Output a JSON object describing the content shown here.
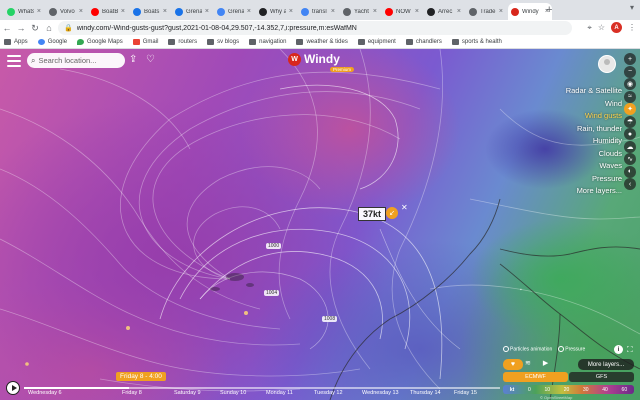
{
  "browser": {
    "tabs": [
      {
        "label": "Whats",
        "favicon_color": "#25d366",
        "active": false
      },
      {
        "label": "Volvo",
        "favicon_color": "#5f6368",
        "active": false
      },
      {
        "label": "BoatB",
        "favicon_color": "#ff0000",
        "active": false
      },
      {
        "label": "Boats",
        "favicon_color": "#1a73e8",
        "active": false
      },
      {
        "label": "Grena",
        "favicon_color": "#1a73e8",
        "active": false
      },
      {
        "label": "Grena",
        "favicon_color": "#4285f4",
        "active": false
      },
      {
        "label": "Why a",
        "favicon_color": "#202124",
        "active": false
      },
      {
        "label": "transl",
        "favicon_color": "#4285f4",
        "active": false
      },
      {
        "label": "Yacht",
        "favicon_color": "#5f6368",
        "active": false
      },
      {
        "label": "NOW",
        "favicon_color": "#ff0000",
        "active": false
      },
      {
        "label": "Arrec",
        "favicon_color": "#202124",
        "active": false
      },
      {
        "label": "Trade",
        "favicon_color": "#5f6368",
        "active": false
      },
      {
        "label": "Windy",
        "favicon_color": "#d8271c",
        "active": true
      }
    ],
    "url": "windy.com/-Wind-gusts-gust?gust,2021-01-08-04,29.507,-14.352,7,i:pressure,m:esWafMN",
    "profile_initial": "A",
    "bookmarks": [
      "Apps",
      "Google",
      "Google Maps",
      "Gmail",
      "routers",
      "sv blogs",
      "navigation",
      "weather & tides",
      "equipment",
      "chandlers",
      "sports & health"
    ]
  },
  "map": {
    "search_placeholder": "Search location...",
    "logo_text": "Windy",
    "logo_badge": "Premium",
    "layers": [
      {
        "label": "Radar & Satellite",
        "active": false
      },
      {
        "label": "Wind",
        "active": false
      },
      {
        "label": "Wind gusts",
        "active": true
      },
      {
        "label": "Rain, thunder",
        "active": false
      },
      {
        "label": "Humidity",
        "active": false
      },
      {
        "label": "Clouds",
        "active": false
      },
      {
        "label": "Waves",
        "active": false
      },
      {
        "label": "Pressure",
        "active": false
      },
      {
        "label": "More layers...",
        "active": false
      }
    ],
    "readout": {
      "value": "37kt"
    },
    "isobars": [
      "1000",
      "1004",
      "1008"
    ],
    "toggles": {
      "particles": "Particles animation",
      "pressure": "Pressure"
    },
    "more_layers_btn": "More layers...",
    "models": [
      {
        "label": "ECMWF",
        "active": true
      },
      {
        "label": "GFS",
        "active": false
      }
    ],
    "scale": {
      "unit": "kt",
      "values": [
        "0",
        "10",
        "20",
        "30",
        "40",
        "60"
      ]
    },
    "copyright": "© OpenStreetMap"
  },
  "timeline": {
    "current_time": "Friday 8 - 4:00",
    "progress": 0.22,
    "days": [
      "Wednesday 6",
      "Friday 8",
      "Saturday 9",
      "Sunday 10",
      "Monday 11",
      "Tuesday 12",
      "Wednesday 13",
      "Thursday 14",
      "Friday 15"
    ]
  },
  "colors": {
    "accent": "#f0a020",
    "windy_red": "#d8271c"
  }
}
